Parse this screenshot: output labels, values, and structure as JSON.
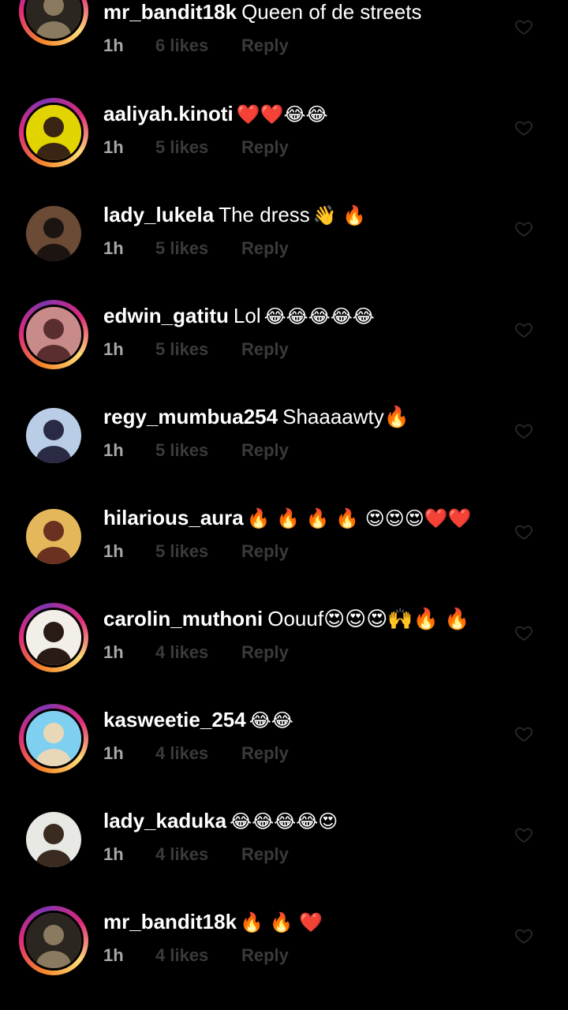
{
  "comments": [
    {
      "username": "mr_bandit18k",
      "text": "Queen of de streets",
      "emoji": "",
      "time": "1h",
      "likes": "6 likes",
      "reply": "Reply",
      "avatar": {
        "story": true,
        "bg": "#2b2620",
        "fg": "#8a7a60"
      }
    },
    {
      "username": "aaliyah.kinoti",
      "text": "",
      "emoji": "❤️❤️😂😂",
      "time": "1h",
      "likes": "5 likes",
      "reply": "Reply",
      "avatar": {
        "story": true,
        "bg": "#e2d400",
        "fg": "#3a2414"
      }
    },
    {
      "username": "lady_lukela",
      "text": "The dress",
      "emoji": "👋 🔥",
      "time": "1h",
      "likes": "5 likes",
      "reply": "Reply",
      "avatar": {
        "story": false,
        "bg": "#6b4a36",
        "fg": "#1c1410"
      }
    },
    {
      "username": "edwin_gatitu",
      "text": "Lol",
      "emoji": "😂😂😂😂😂",
      "time": "1h",
      "likes": "5 likes",
      "reply": "Reply",
      "avatar": {
        "story": true,
        "bg": "#c98a8a",
        "fg": "#5a2e2e"
      }
    },
    {
      "username": "regy_mumbua254",
      "text": "Shaaaawty🔥",
      "emoji": "",
      "time": "1h",
      "likes": "5 likes",
      "reply": "Reply",
      "avatar": {
        "story": false,
        "bg": "#b9cde6",
        "fg": "#2a2a44"
      }
    },
    {
      "username": "hilarious_aura",
      "text": "",
      "emoji": "🔥 🔥 🔥 🔥 😍😍😍❤️❤️",
      "time": "1h",
      "likes": "5 likes",
      "reply": "Reply",
      "avatar": {
        "story": false,
        "bg": "#e4b85a",
        "fg": "#6a3020"
      }
    },
    {
      "username": "carolin_muthoni",
      "text": "Oouuf😍😍😍🙌🔥 🔥",
      "emoji": "",
      "time": "1h",
      "likes": "4 likes",
      "reply": "Reply",
      "avatar": {
        "story": true,
        "bg": "#f2eee8",
        "fg": "#2a1a14"
      }
    },
    {
      "username": "kasweetie_254",
      "text": "",
      "emoji": "😂😂",
      "time": "1h",
      "likes": "4 likes",
      "reply": "Reply",
      "avatar": {
        "story": true,
        "bg": "#7fd0f0",
        "fg": "#e9d8b8"
      }
    },
    {
      "username": "lady_kaduka",
      "text": "",
      "emoji": "😂😂😂😂😍",
      "time": "1h",
      "likes": "4 likes",
      "reply": "Reply",
      "avatar": {
        "story": false,
        "bg": "#e8e8e4",
        "fg": "#3a2a20"
      }
    },
    {
      "username": "mr_bandit18k",
      "text": "",
      "emoji": "🔥 🔥 ❤️",
      "time": "1h",
      "likes": "4 likes",
      "reply": "Reply",
      "avatar": {
        "story": true,
        "bg": "#2b2620",
        "fg": "#8a7a60"
      }
    }
  ],
  "colors": {
    "background": "#000000",
    "username": "#ffffff",
    "meta": "#a8a8a8",
    "muted": "#3a3a3a",
    "heart": "#2a2a2a"
  },
  "icons": {
    "like": "heart-outline-icon"
  }
}
